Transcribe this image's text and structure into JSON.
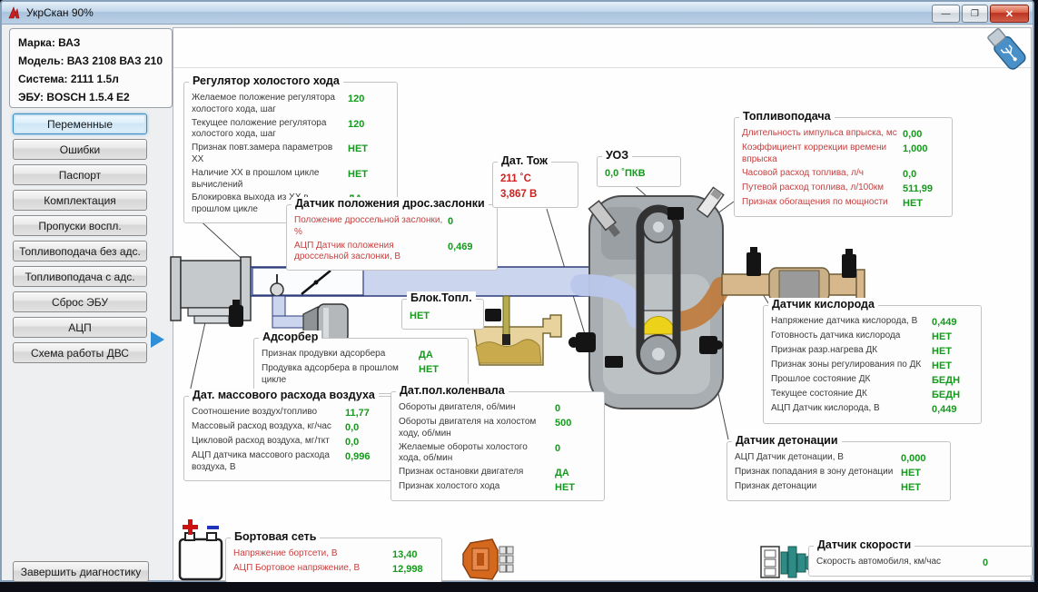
{
  "window": {
    "title": "УкрСкан 90%",
    "controls": {
      "minimize": "—",
      "maximize": "❐",
      "close": "✕"
    }
  },
  "colors": {
    "value_green": "#149a1c",
    "label_red": "#c74040",
    "value_red": "#cc2222",
    "active_button_blue": "#3c8ac0",
    "titlebar_blue": "#b9cfe4"
  },
  "icons": [
    "app-logo-icon",
    "usb-icon",
    "battery-icon",
    "ecu-connector-icon",
    "speed-sensor-icon",
    "engine-block-icon",
    "air-filter-icon",
    "adsorber-canister-icon",
    "fuel-tank-icon",
    "catalyst-icon",
    "oxygen-sensor-icon",
    "arrow-right-icon"
  ],
  "info": {
    "lines": [
      "Марка: ВАЗ",
      "Модель: ВАЗ 2108 ВАЗ 210",
      "Система: 2111 1.5л",
      "ЭБУ: BOSCH 1.5.4 E2"
    ]
  },
  "sidebar": {
    "items": [
      {
        "name": "variables",
        "label": "Переменные",
        "active": true
      },
      {
        "name": "errors",
        "label": "Ошибки",
        "active": false
      },
      {
        "name": "passport",
        "label": "Паспорт",
        "active": false
      },
      {
        "name": "equipment",
        "label": "Комплектация",
        "active": false
      },
      {
        "name": "misfires",
        "label": "Пропуски воспл.",
        "active": false
      },
      {
        "name": "fuel-without-ads",
        "label": "Топливоподача без адс.",
        "active": false
      },
      {
        "name": "fuel-with-ads",
        "label": "Топливоподача с адс.",
        "active": false
      },
      {
        "name": "ecu-reset",
        "label": "Сброс ЭБУ",
        "active": false
      },
      {
        "name": "adc",
        "label": "АЦП",
        "active": false
      },
      {
        "name": "engine-scheme",
        "label": "Схема работы ДВС",
        "active": false
      }
    ],
    "finish_label": "Завершить диагностику"
  },
  "panels": [
    {
      "id": "idle-regulator",
      "title": "Регулятор холостого хода",
      "label_style": "dark",
      "rows": [
        {
          "label": "Желаемое положение регулятора холостого хода, шаг",
          "value": "120"
        },
        {
          "label": "Текущее положение регулятора холостого хода, шаг",
          "value": "120"
        },
        {
          "label": "Признак повт.замера параметров ХХ",
          "value": "НЕТ"
        },
        {
          "label": "Наличие ХХ в прошлом цикле вычислений",
          "value": "НЕТ"
        },
        {
          "label": "Блокировка выхода из ХХ в прошлом цикле",
          "value": "ДА"
        }
      ]
    },
    {
      "id": "throttle-position",
      "title": "Датчик положения дрос.заслонки",
      "label_style": "red",
      "rows": [
        {
          "label": "Положение дроссельной заслонки, %",
          "value": "0"
        },
        {
          "label": "АЦП Датчик положения дроссельной заслонки, В",
          "value": "0,469"
        }
      ]
    },
    {
      "id": "coolant-temp",
      "title": "Дат. Тож",
      "label_style": "dark",
      "value_style": "red",
      "rows": [
        {
          "label": "",
          "value": "211 ˚C"
        },
        {
          "label": "",
          "value": "3,867 В"
        }
      ]
    },
    {
      "id": "ignition-advance",
      "title": "УОЗ",
      "label_style": "dark",
      "rows": [
        {
          "label": "",
          "value": "0,0 ˚ПКВ"
        }
      ]
    },
    {
      "id": "fuel-delivery",
      "title": "Топливоподача",
      "label_style": "red",
      "rows": [
        {
          "label": "Длительность импульса впрыска, мс",
          "value": "0,00"
        },
        {
          "label": "Коэффициент коррекции времени впрыска",
          "value": "1,000"
        },
        {
          "label": "Часовой расход топлива, л/ч",
          "value": "0,0"
        },
        {
          "label": "Путевой расход топлива, л/100км",
          "value": "511,99"
        },
        {
          "label": "Признак обогащения по мощности",
          "value": "НЕТ"
        }
      ]
    },
    {
      "id": "fuel-block",
      "title": "Блок.Топл.",
      "label_style": "dark",
      "rows": [
        {
          "label": "",
          "value": "НЕТ"
        }
      ]
    },
    {
      "id": "adsorber",
      "title": "Адсорбер",
      "label_style": "dark",
      "rows": [
        {
          "label": "Признак продувки адсорбера",
          "value": "ДА"
        },
        {
          "label": "Продувка адсорбера в прошлом цикле",
          "value": "НЕТ"
        }
      ]
    },
    {
      "id": "maf",
      "title": "Дат. массового расхода воздуха",
      "label_style": "dark",
      "rows": [
        {
          "label": "Соотношение воздух/топливо",
          "value": "11,77"
        },
        {
          "label": "Массовый расход воздуха, кг/час",
          "value": "0,0"
        },
        {
          "label": "Цикловой расход воздуха, мг/ткт",
          "value": "0,0"
        },
        {
          "label": "АЦП датчика массового расхода воздуха, В",
          "value": "0,996"
        }
      ]
    },
    {
      "id": "crankshaft",
      "title": "Дат.пол.коленвала",
      "label_style": "dark",
      "rows": [
        {
          "label": "Обороты двигателя, об/мин",
          "value": "0"
        },
        {
          "label": "Обороты двигателя на холостом ходу, об/мин",
          "value": "500"
        },
        {
          "label": "Желаемые обороты холостого хода, об/мин",
          "value": "0"
        },
        {
          "label": "Признак остановки двигателя",
          "value": "ДА"
        },
        {
          "label": "Признак холостого хода",
          "value": "НЕТ"
        }
      ]
    },
    {
      "id": "oxygen",
      "title": "Датчик кислорода",
      "label_style": "dark",
      "rows": [
        {
          "label": "Напряжение датчика кислорода, В",
          "value": "0,449"
        },
        {
          "label": "Готовность датчика кислорода",
          "value": "НЕТ"
        },
        {
          "label": "Признак разр.нагрева ДК",
          "value": "НЕТ"
        },
        {
          "label": "Признак зоны регулирования по ДК",
          "value": "НЕТ"
        },
        {
          "label": "Прошлое состояние ДК",
          "value": "БЕДН"
        },
        {
          "label": "Текущее состояние ДК",
          "value": "БЕДН"
        },
        {
          "label": "АЦП Датчик кислорода, В",
          "value": "0,449"
        }
      ]
    },
    {
      "id": "knock",
      "title": "Датчик детонации",
      "label_style": "dark",
      "rows": [
        {
          "label": "АЦП Датчик детонации, В",
          "value": "0,000"
        },
        {
          "label": "Признак попадания в зону детонации",
          "value": "НЕТ"
        },
        {
          "label": "Признак детонации",
          "value": "НЕТ"
        }
      ]
    },
    {
      "id": "board-net",
      "title": "Бортовая сеть",
      "label_style": "red",
      "rows": [
        {
          "label": "Напряжение бортсети, В",
          "value": "13,40"
        },
        {
          "label": "АЦП Бортовое напряжение, В",
          "value": "12,998"
        }
      ]
    },
    {
      "id": "speed",
      "title": "Датчик скорости",
      "label_style": "dark",
      "rows": [
        {
          "label": "Скорость автомобиля, км/час",
          "value": "0"
        }
      ]
    }
  ]
}
